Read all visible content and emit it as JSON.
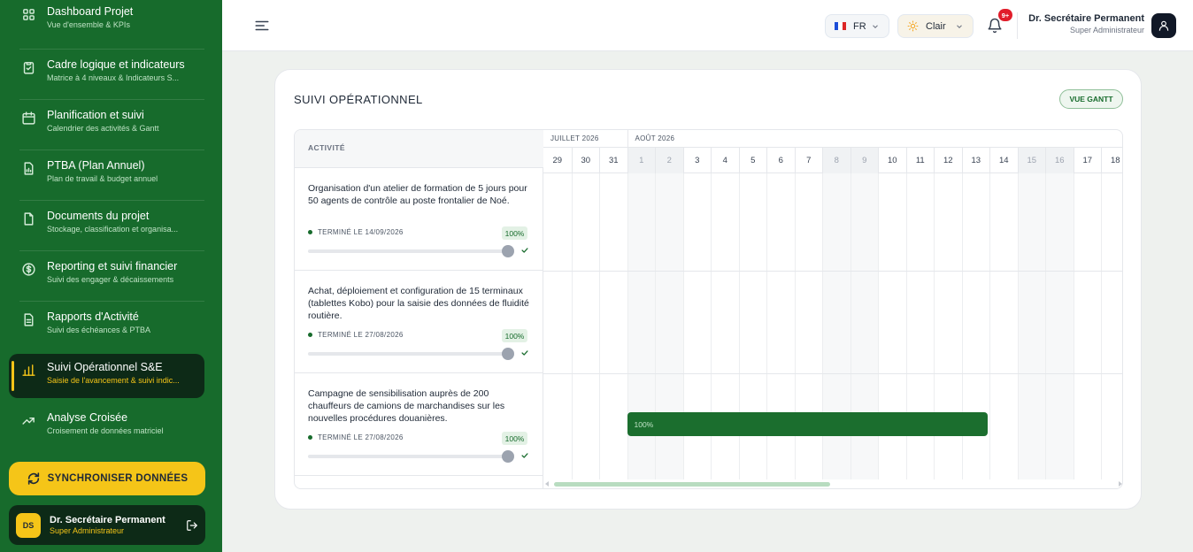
{
  "sidebar": {
    "items": [
      {
        "label": "Dashboard Projet",
        "sub": "Vue d'ensemble & KPIs",
        "icon": "grid-icon"
      },
      {
        "label": "Cadre logique et indicateurs",
        "sub": "Matrice à 4 niveaux & Indicateurs S...",
        "icon": "clipboard-check-icon"
      },
      {
        "label": "Planification et suivi",
        "sub": "Calendrier des activités & Gantt",
        "icon": "calendar-icon"
      },
      {
        "label": "PTBA (Plan Annuel)",
        "sub": "Plan de travail & budget annuel",
        "icon": "document-chart-icon"
      },
      {
        "label": "Documents du projet",
        "sub": "Stockage, classification et organisa...",
        "icon": "file-icon"
      },
      {
        "label": "Reporting et suivi financier",
        "sub": "Suivi des engager & décaissements",
        "icon": "dollar-circle-icon"
      },
      {
        "label": "Rapports d'Activité",
        "sub": "Suivi des échéances & PTBA",
        "icon": "file-text-icon"
      },
      {
        "label": "Suivi Opérationnel S&E",
        "sub": "Saisie de l'avancement & suivi indic...",
        "icon": "bar-chart-icon"
      },
      {
        "label": "Analyse Croisée",
        "sub": "Croisement de données matriciel",
        "icon": "trending-up-icon"
      }
    ],
    "active_index": 7,
    "sync_label": "SYNCHRONISER DONNÉES",
    "user": {
      "initials": "DS",
      "name": "Dr. Secrétaire Permanent",
      "role": "Super Administrateur"
    }
  },
  "header": {
    "language": "FR",
    "theme": "Clair",
    "notification_badge": "9+",
    "user_name": "Dr. Secrétaire Permanent",
    "user_role": "Super Administrateur"
  },
  "main": {
    "title": "SUIVI OPÉRATIONNEL",
    "gantt_button": "VUE GANTT",
    "activity_header": "ACTIVITÉ",
    "months": [
      {
        "label": "JUILLET 2026",
        "start_day_index": 0,
        "span": 3
      },
      {
        "label": "AOÛT 2026",
        "start_day_index": 3,
        "span": 18
      }
    ],
    "days": [
      {
        "d": "29",
        "weekend": false
      },
      {
        "d": "30",
        "weekend": false
      },
      {
        "d": "31",
        "weekend": false
      },
      {
        "d": "1",
        "weekend": true
      },
      {
        "d": "2",
        "weekend": true
      },
      {
        "d": "3",
        "weekend": false
      },
      {
        "d": "4",
        "weekend": false
      },
      {
        "d": "5",
        "weekend": false
      },
      {
        "d": "6",
        "weekend": false
      },
      {
        "d": "7",
        "weekend": false
      },
      {
        "d": "8",
        "weekend": true
      },
      {
        "d": "9",
        "weekend": true
      },
      {
        "d": "10",
        "weekend": false
      },
      {
        "d": "11",
        "weekend": false
      },
      {
        "d": "12",
        "weekend": false
      },
      {
        "d": "13",
        "weekend": false
      },
      {
        "d": "14",
        "weekend": false
      },
      {
        "d": "15",
        "weekend": true
      },
      {
        "d": "16",
        "weekend": true
      },
      {
        "d": "17",
        "weekend": false
      },
      {
        "d": "18",
        "weekend": false
      }
    ],
    "activities": [
      {
        "title": "Organisation d'un atelier de formation de 5 jours pour 50 agents de contrôle au poste frontalier de Noé.",
        "status": "TERMINÉ LE 14/09/2026",
        "percent_label": "100%",
        "progress": 1.0
      },
      {
        "title": "Achat, déploiement et configuration de 15 terminaux (tablettes Kobo) pour la saisie des données de fluidité routière.",
        "status": "TERMINÉ LE 27/08/2026",
        "percent_label": "100%",
        "progress": 1.0
      },
      {
        "title": "Campagne de sensibilisation auprès de 200 chauffeurs de camions de marchandises sur les nouvelles procédures douanières.",
        "status": "TERMINÉ LE 27/08/2026",
        "percent_label": "100%",
        "progress": 1.0,
        "bar": {
          "start_day_index": 3,
          "end_day_index": 16,
          "label": "100%"
        }
      }
    ]
  },
  "colors": {
    "sidebar_bg": "#176b2c",
    "active_bg": "#0d2a17",
    "accent_yellow": "#f5c518",
    "bar_green": "#1b6e2e",
    "badge_red": "#e11d2a"
  }
}
